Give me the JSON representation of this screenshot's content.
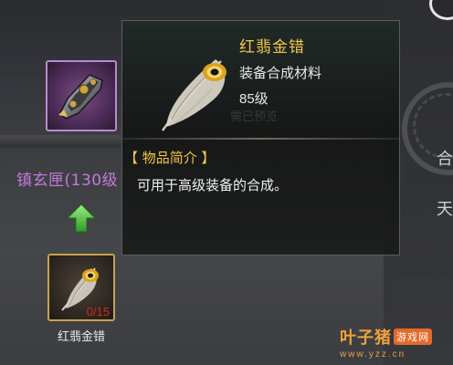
{
  "left_panel": {
    "equipment_name": "镇玄匣(130级",
    "material_label": "红翡金错",
    "material_count": "0/15"
  },
  "tooltip": {
    "item_name": "红翡金错",
    "item_type": "装备合成材料",
    "item_level": "85级",
    "section_title": "【 物品简介 】",
    "description": "可用于高级装备的合成。"
  },
  "background": {
    "obscured_text": "需已预览"
  },
  "right_edge": {
    "glyphs": [
      "合",
      "天"
    ]
  },
  "watermark": {
    "title": "叶子猪",
    "tag": "游戏网",
    "url": "www.yzz.cn"
  },
  "colors": {
    "item_name_gold": "#f3c64a",
    "equipment_purple": "#c27ad9",
    "count_red": "#d22a1f",
    "slot_border_gold": "#c8a24a",
    "arrow_green": "#4fc84a"
  },
  "icons": {
    "weapon": "weapon-box-icon",
    "feather": "peacock-feather-icon",
    "arrow": "up-arrow-icon"
  }
}
